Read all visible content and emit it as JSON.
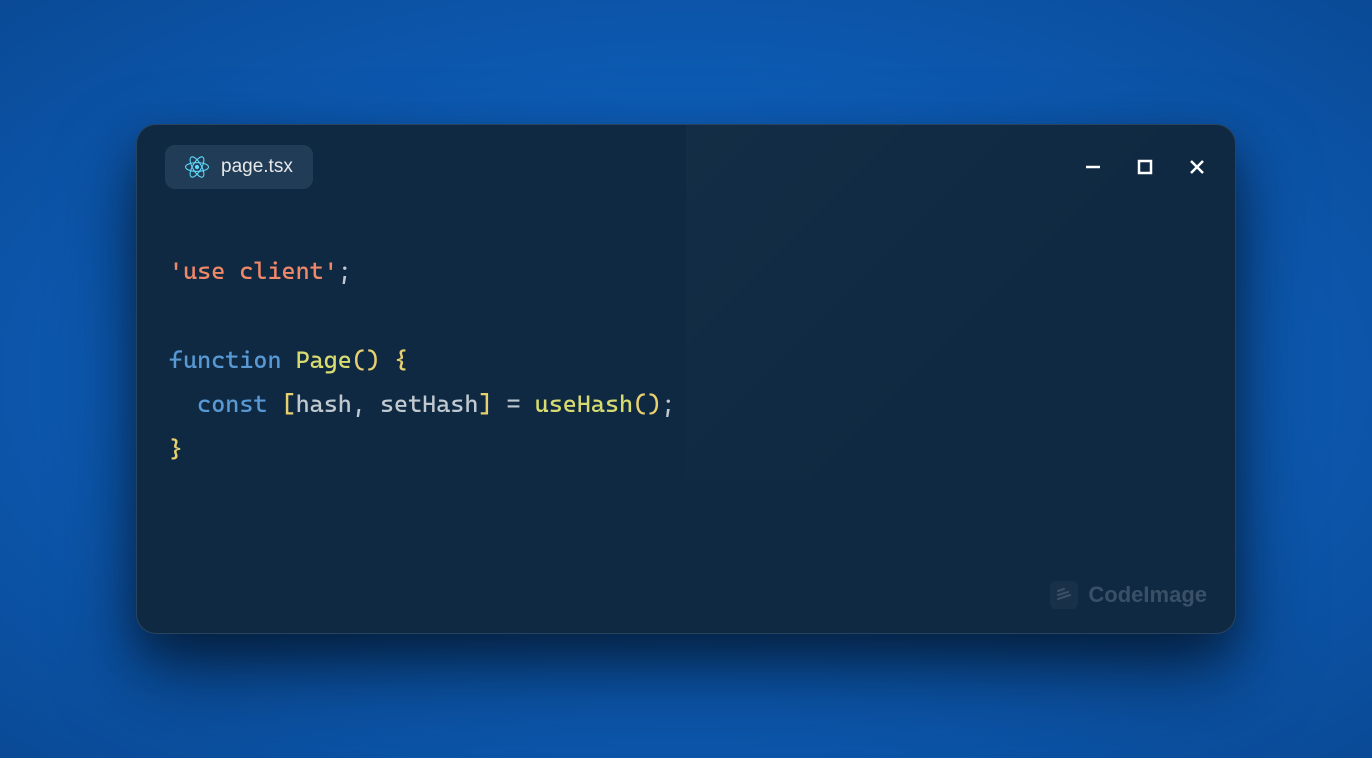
{
  "tab": {
    "filename": "page.tsx",
    "icon": "react-icon"
  },
  "window_controls": {
    "minimize": "minimize",
    "maximize": "maximize",
    "close": "close"
  },
  "code": {
    "lines": [
      {
        "tokens": [
          {
            "t": "'use client'",
            "c": "tok-string"
          },
          {
            "t": ";",
            "c": "tok-semi"
          }
        ]
      },
      {
        "tokens": []
      },
      {
        "tokens": [
          {
            "t": "function",
            "c": "tok-keyword"
          },
          {
            "t": " ",
            "c": ""
          },
          {
            "t": "Page",
            "c": "tok-function"
          },
          {
            "t": "()",
            "c": "tok-paren"
          },
          {
            "t": " ",
            "c": ""
          },
          {
            "t": "{",
            "c": "tok-brace"
          }
        ]
      },
      {
        "tokens": [
          {
            "t": "  ",
            "c": ""
          },
          {
            "t": "const",
            "c": "tok-const"
          },
          {
            "t": " ",
            "c": ""
          },
          {
            "t": "[",
            "c": "tok-bracket"
          },
          {
            "t": "hash",
            "c": "tok-var"
          },
          {
            "t": ", ",
            "c": "tok-var"
          },
          {
            "t": "setHash",
            "c": "tok-var"
          },
          {
            "t": "]",
            "c": "tok-bracket"
          },
          {
            "t": " = ",
            "c": "tok-op"
          },
          {
            "t": "useHash",
            "c": "tok-call"
          },
          {
            "t": "()",
            "c": "tok-paren"
          },
          {
            "t": ";",
            "c": "tok-semi"
          }
        ]
      },
      {
        "tokens": [
          {
            "t": "}",
            "c": "tok-brace"
          }
        ]
      }
    ]
  },
  "watermark": {
    "label": "CodeImage"
  },
  "colors": {
    "bg_gradient_center": "#1a8cff",
    "bg_gradient_mid": "#0d5cb6",
    "bg_gradient_edge": "#0a4a96",
    "editor_bg": "#0f2942",
    "string": "#f08868",
    "keyword": "#5899d4",
    "function": "#d8dc70",
    "bracket": "#e8d070"
  }
}
